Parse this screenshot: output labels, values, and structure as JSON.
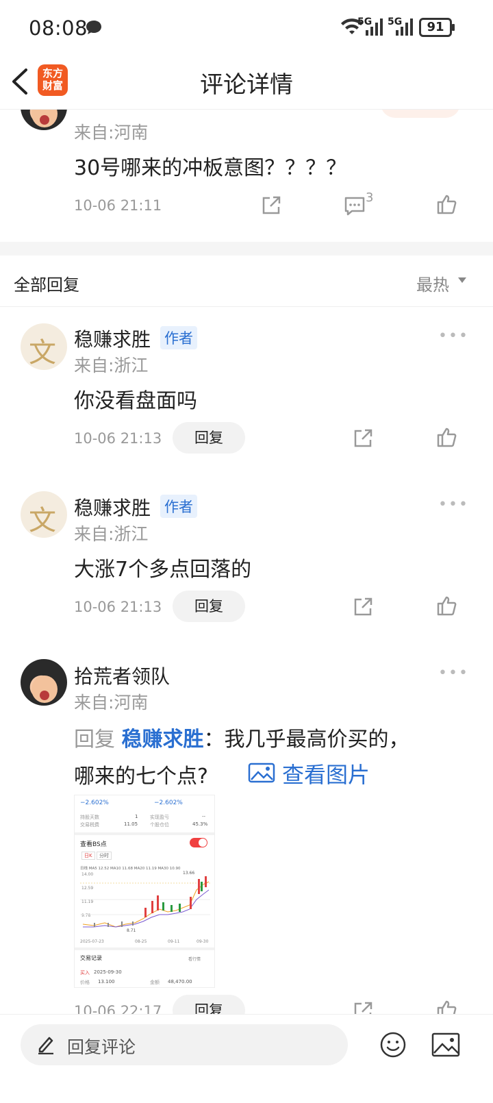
{
  "status_bar": {
    "time": "08:08",
    "network1": "5G",
    "network2": "5G",
    "battery": "91"
  },
  "header": {
    "title": "评论详情",
    "logo_line1": "东方",
    "logo_line2": "财富"
  },
  "main_comment": {
    "from": "来自:河南",
    "text": "30号哪来的冲板意图？？？？",
    "time": "10-06 21:11",
    "reply_count": "3"
  },
  "replies_header": {
    "label": "全部回复",
    "sort": "最热"
  },
  "replies": [
    {
      "name": "稳赚求胜",
      "tag": "作者",
      "from": "来自:浙江",
      "text": "你没看盘面吗",
      "time": "10-06 21:13",
      "reply_label": "回复"
    },
    {
      "name": "稳赚求胜",
      "tag": "作者",
      "from": "来自:浙江",
      "text": "大涨7个多点回落的",
      "time": "10-06 21:13",
      "reply_label": "回复"
    },
    {
      "name": "拾荒者领队",
      "from": "来自:河南",
      "reply_prefix": "回复",
      "reply_target": "稳赚求胜",
      "text_line1": "：我几乎最高价买的，",
      "text_line2": "哪来的七个点?",
      "view_image": "查看图片",
      "time": "10-06 22:17",
      "reply_label": "回复"
    }
  ],
  "thumbnail": {
    "pct1": "−2.602%",
    "pct2": "−2.602%",
    "hold_days_label": "持股天数",
    "hold_days": "1",
    "fee_label": "交易税费",
    "fee": "11.05",
    "profit_label": "实现盈亏",
    "profit": "--",
    "position_label": "个股仓位",
    "position": "45.3%",
    "bs_label": "查看BS点",
    "kline_tab": "日K",
    "fenshi_tab": "分时",
    "ma_line": "日线 MA5 12.52 MA10 11.68 MA20 11.19 MA30 10.90",
    "y1": "14.00",
    "y2": "12.59",
    "y3": "11.19",
    "y4": "9.78",
    "hi": "13.66",
    "lo": "8.71",
    "x1": "2025-07-23",
    "x2": "08-25",
    "x3": "09-11",
    "x4": "09-30",
    "record_label": "交易记录",
    "view_quote": "看行情",
    "buy_label": "买入",
    "buy_date": "2025-09-30",
    "price_label": "价格",
    "price": "13.100",
    "amount_label": "金额",
    "amount": "48,470.00"
  },
  "bottom_bar": {
    "placeholder": "回复评论"
  }
}
